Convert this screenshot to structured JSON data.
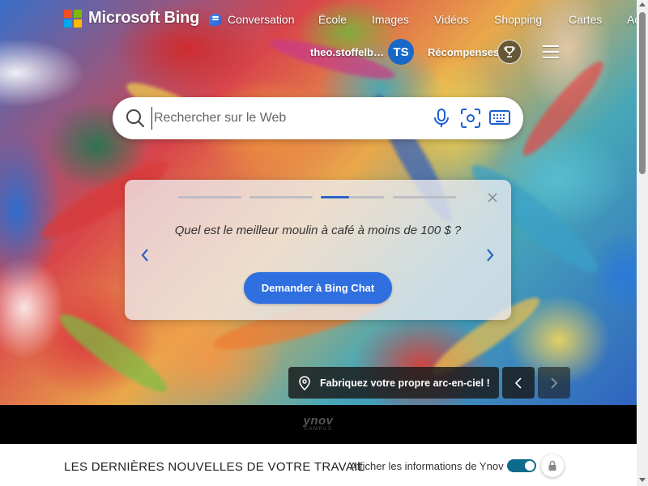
{
  "brand": {
    "name": "Microsoft Bing",
    "logo_colors": [
      "#f25022",
      "#7fba00",
      "#00a4ef",
      "#ffb900"
    ]
  },
  "nav": {
    "items": [
      {
        "label": "Conversation",
        "icon": "chat-icon"
      },
      {
        "label": "École"
      },
      {
        "label": "Images"
      },
      {
        "label": "Vidéos"
      },
      {
        "label": "Shopping"
      },
      {
        "label": "Cartes"
      },
      {
        "label": "Ac"
      }
    ]
  },
  "account": {
    "username": "theo.stoffelba...",
    "initials": "TS",
    "rewards_label": "Récompenses",
    "avatar_color": "#1769c9"
  },
  "search": {
    "placeholder": "Rechercher sur le Web",
    "value": ""
  },
  "suggestion": {
    "question": "Quel est le meilleur moulin à café à moins de 100 $ ?",
    "button_label": "Demander à Bing Chat",
    "slide_count": 4,
    "active_slide": 3,
    "accent": "#2f6fe0"
  },
  "image": {
    "caption": "Fabriquez votre propre arc-en-ciel !"
  },
  "partner": {
    "logo_main": "ynov",
    "logo_sub": "CAMPUS"
  },
  "news": {
    "title": "LES DERNIÈRES NOUVELLES DE VOTRE TRAVAIL",
    "toggle_label": "Afficher les informations de Ynov",
    "toggle_on": true,
    "toggle_color": "#0f6b8c"
  }
}
